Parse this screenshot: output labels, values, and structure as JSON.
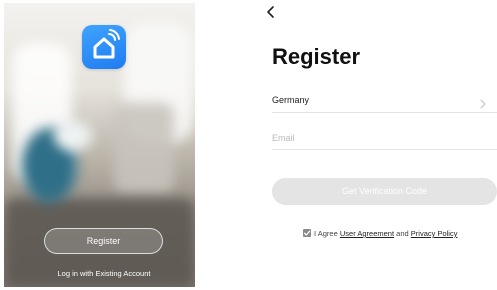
{
  "splash": {
    "app_icon": "smart-home-icon",
    "register_label": "Register",
    "login_link": "Log in with Existing Account"
  },
  "register_form": {
    "back_icon": "chevron-left-icon",
    "title": "Register",
    "country_value": "Germany",
    "country_chevron_icon": "chevron-right-icon",
    "email_placeholder": "Email",
    "email_value": "",
    "verify_button_label": "Get Verification Code",
    "agreement": {
      "checked": true,
      "prefix": "I Agree",
      "user_agreement_link": "User Agreement",
      "and_text": "and",
      "privacy_policy_link": "Privacy Policy"
    }
  },
  "colors": {
    "icon_blue": "#2a8df7",
    "disabled_button": "#e4e4e4",
    "title_text": "#111111"
  }
}
